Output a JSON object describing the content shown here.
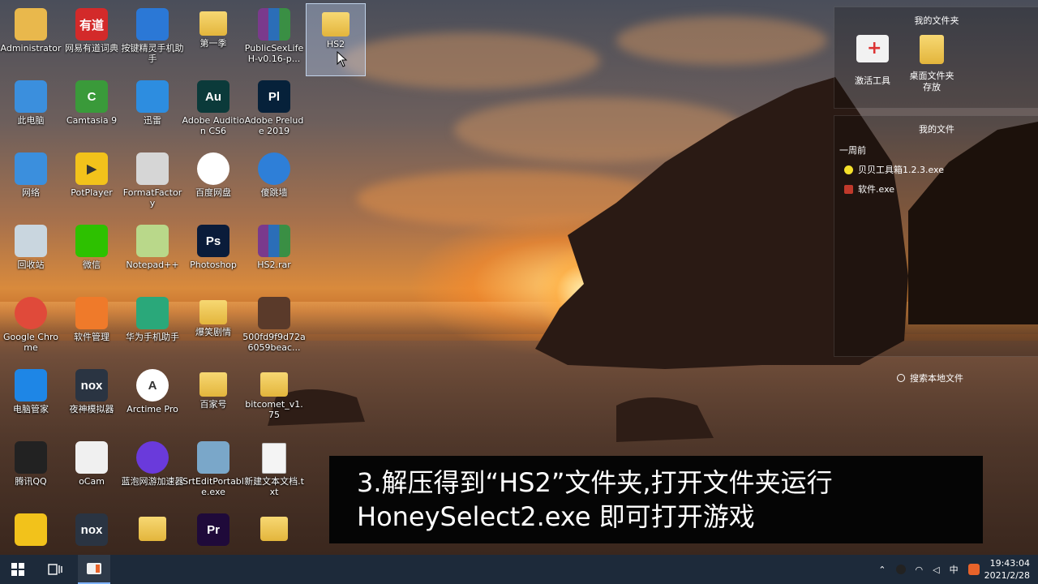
{
  "desktop": {
    "icons": [
      {
        "label": "Administrator",
        "glyph": "person-icon",
        "color": "#e9b84c"
      },
      {
        "label": "网易有道词典",
        "glyph": "youdao-icon",
        "color": "#d32a2a",
        "text": "有道"
      },
      {
        "label": "按键精灵手机助手",
        "glyph": "robot-icon",
        "color": "#2b78d6"
      },
      {
        "label": "第一季",
        "glyph": "folder-icon"
      },
      {
        "label": "PublicSexLifeH-v0.16-p...",
        "glyph": "rar-icon"
      },
      {
        "label": "HS2",
        "glyph": "folder-icon"
      },
      {
        "label": "此电脑",
        "glyph": "computer-icon",
        "color": "#3b8fdd"
      },
      {
        "label": "Camtasia 9",
        "glyph": "camtasia-icon",
        "color": "#3a9a3a",
        "text": "C"
      },
      {
        "label": "迅雷",
        "glyph": "xunlei-icon",
        "color": "#2d8de0"
      },
      {
        "label": "Adobe Audition CS6",
        "glyph": "audition-icon",
        "color": "#0b3a3a",
        "text": "Au"
      },
      {
        "label": "Adobe Prelude 2019",
        "glyph": "prelude-icon",
        "color": "#06213a",
        "text": "Pl"
      },
      {
        "label": "网络",
        "glyph": "network-icon",
        "color": "#3b8fdd"
      },
      {
        "label": "PotPlayer",
        "glyph": "potplayer-icon",
        "color": "#f2c21b",
        "text": "▶"
      },
      {
        "label": "FormatFactory",
        "glyph": "formatfactory-icon",
        "color": "#d6d6d6"
      },
      {
        "label": "百度网盘",
        "glyph": "baidu-icon",
        "color": "#ffffff"
      },
      {
        "label": "傻跳墙",
        "glyph": "face-icon",
        "color": "#2e7fd8"
      },
      {
        "label": "回收站",
        "glyph": "recycle-bin-icon",
        "color": "#c9d6df"
      },
      {
        "label": "微信",
        "glyph": "wechat-icon",
        "color": "#2dc100"
      },
      {
        "label": "Notepad++",
        "glyph": "notepadpp-icon",
        "color": "#b9d88a"
      },
      {
        "label": "Photoshop",
        "glyph": "photoshop-icon",
        "color": "#0a1c3a",
        "text": "Ps"
      },
      {
        "label": "HS2.rar",
        "glyph": "rar-icon"
      },
      {
        "label": "Google Chrome",
        "glyph": "chrome-icon",
        "color": "#e04a3a"
      },
      {
        "label": "软件管理",
        "glyph": "software-manager-icon",
        "color": "#ef7a2a"
      },
      {
        "label": "华为手机助手",
        "glyph": "huawei-icon",
        "color": "#2aa87a"
      },
      {
        "label": "爆笑剧情",
        "glyph": "folder-icon"
      },
      {
        "label": "500fd9f9d72a6059beac...",
        "glyph": "image-icon",
        "color": "#5a3a2a"
      },
      {
        "label": "电脑管家",
        "glyph": "pc-manager-icon",
        "color": "#1e86e6"
      },
      {
        "label": "夜神模拟器",
        "glyph": "nox-icon",
        "color": "#2a3442",
        "text": "nox"
      },
      {
        "label": "Arctime Pro",
        "glyph": "arctime-icon",
        "color": "#ffffff",
        "text": "A"
      },
      {
        "label": "百家号",
        "glyph": "folder-icon"
      },
      {
        "label": "bitcomet_v1.75",
        "glyph": "folder-icon"
      },
      {
        "label": "腾讯QQ",
        "glyph": "qq-icon",
        "color": "#222222"
      },
      {
        "label": "oCam",
        "glyph": "ocam-icon",
        "color": "#f0f0f0"
      },
      {
        "label": "蓝泡网游加速器",
        "glyph": "accelerator-icon",
        "color": "#6a3adb"
      },
      {
        "label": "SrtEditPortable.exe",
        "glyph": "srtedit-icon",
        "color": "#7aa7c9"
      },
      {
        "label": "新建文本文档.txt",
        "glyph": "text-file-icon"
      },
      {
        "label": "",
        "glyph": "app-icon",
        "color": "#f2c21b"
      },
      {
        "label": "",
        "glyph": "nox-icon",
        "color": "#2a3442",
        "text": "nox"
      },
      {
        "label": "",
        "glyph": "folder-icon"
      },
      {
        "label": "",
        "glyph": "premiere-icon",
        "color": "#1f0a3a",
        "text": "Pr"
      },
      {
        "label": "",
        "glyph": "folder-icon"
      }
    ]
  },
  "panel": {
    "section1_title": "我的文件夹",
    "section1_items": [
      {
        "label": "激活工具",
        "glyph": "toolkit-icon"
      },
      {
        "label": "桌面文件夹存放",
        "glyph": "folder-icon"
      }
    ],
    "section2_title": "我的文件",
    "group_label": "一周前",
    "section2_items": [
      {
        "label": "贝贝工具箱1.2.3.exe",
        "glyph": "yellow-dot-icon"
      },
      {
        "label": "软件.exe",
        "glyph": "exe-icon"
      }
    ],
    "search_label": "搜索本地文件"
  },
  "subtitle": {
    "line1": "3.解压得到“HS2”文件夹,打开文件夹运行",
    "line2": "HoneySelect2.exe  即可打开游戏"
  },
  "taskbar": {
    "tray_ime": "中",
    "time": "19:43:04",
    "date": "2021/2/28"
  }
}
